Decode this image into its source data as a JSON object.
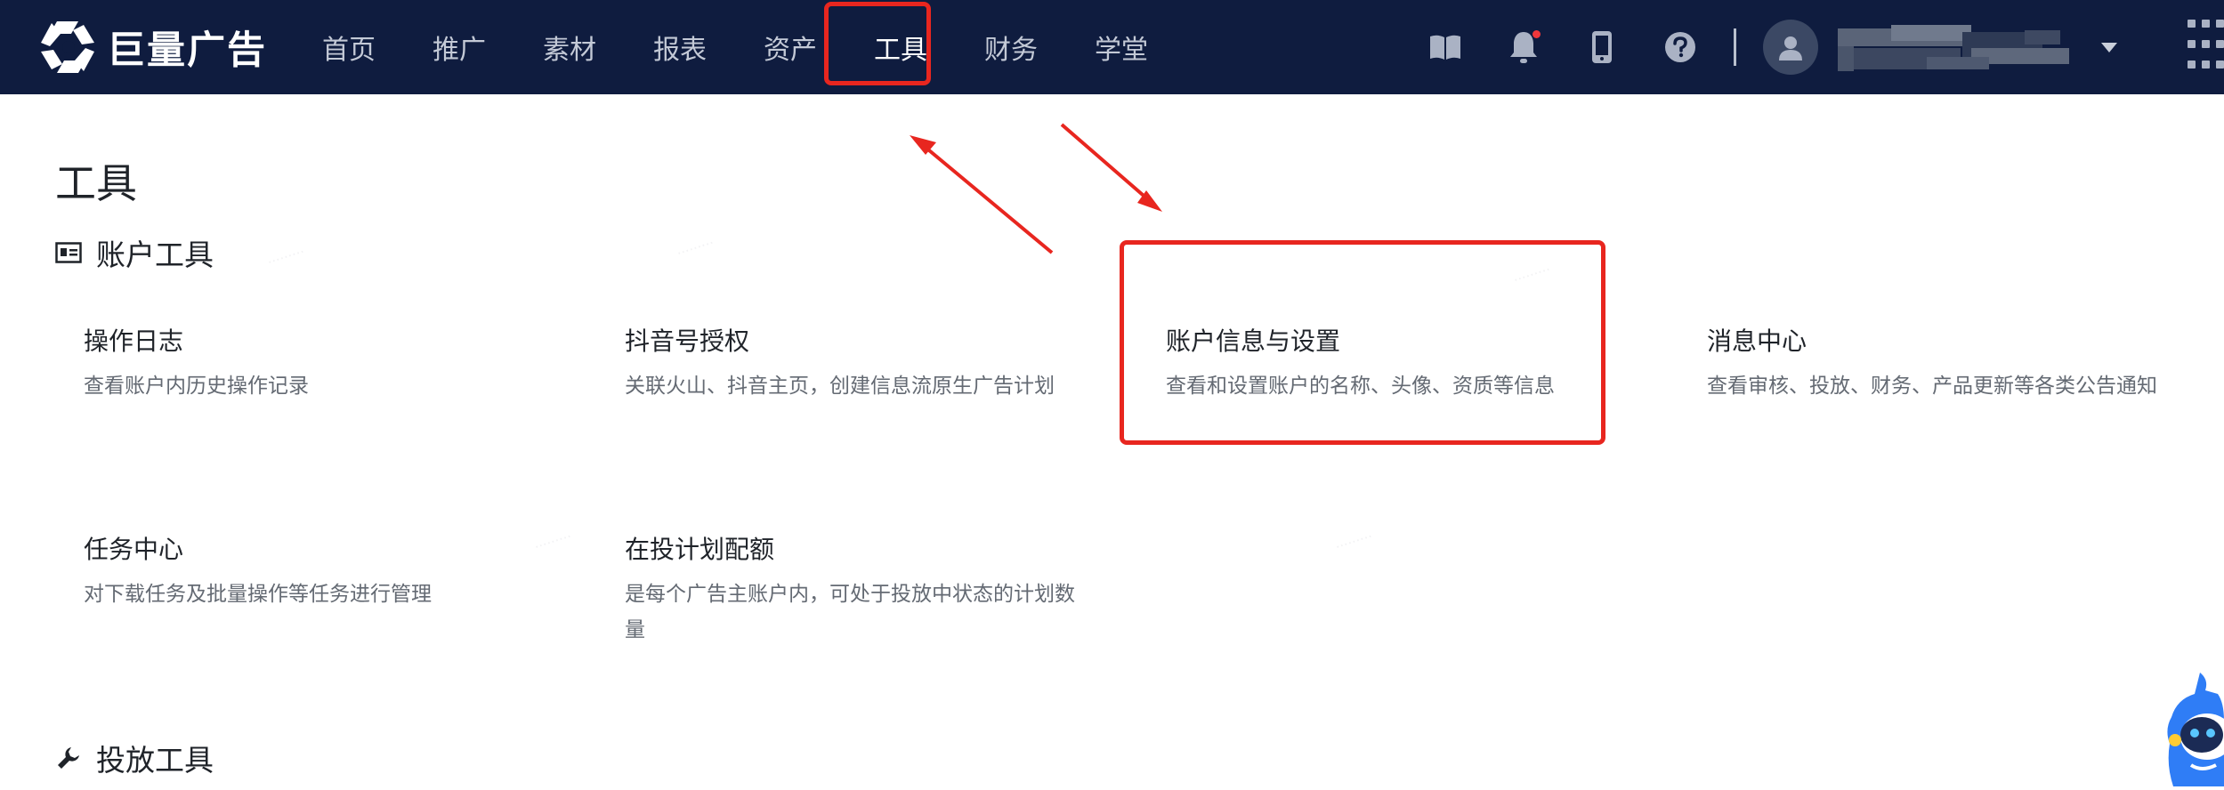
{
  "brand": {
    "name": "巨量广告"
  },
  "nav": {
    "items": [
      {
        "label": "首页"
      },
      {
        "label": "推广"
      },
      {
        "label": "素材"
      },
      {
        "label": "报表"
      },
      {
        "label": "资产"
      },
      {
        "label": "工具"
      },
      {
        "label": "财务"
      },
      {
        "label": "学堂"
      }
    ],
    "active": "工具"
  },
  "header_icons": [
    "book-icon",
    "bell-icon",
    "phone-icon",
    "help-icon"
  ],
  "page": {
    "title": "工具"
  },
  "sections": [
    {
      "title": "账户工具",
      "icon": "id-card-icon",
      "tools": [
        {
          "title": "操作日志",
          "desc": "查看账户内历史操作记录"
        },
        {
          "title": "抖音号授权",
          "desc": "关联火山、抖音主页，创建信息流原生广告计划"
        },
        {
          "title": "账户信息与设置",
          "desc": "查看和设置账户的名称、头像、资质等信息"
        },
        {
          "title": "消息中心",
          "desc": "查看审核、投放、财务、产品更新等各类公告通知"
        },
        {
          "title": "任务中心",
          "desc": "对下载任务及批量操作等任务进行管理"
        },
        {
          "title": "在投计划配额",
          "desc": "是每个广告主账户内，可处于投放中状态的计划数量"
        }
      ]
    },
    {
      "title": "投放工具",
      "icon": "wrench-icon"
    }
  ],
  "colors": {
    "topbar": "#0f1c3f",
    "nav_text": "#c3c9d6",
    "annotation_red": "#e8261f",
    "notification_dot": "#f0373b"
  }
}
